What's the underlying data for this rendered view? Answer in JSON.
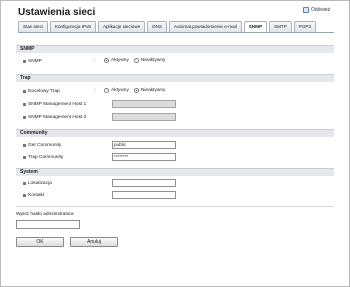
{
  "header": {
    "title": "Ustawienia sieci",
    "refresh_label": "Odśwież"
  },
  "tabs": [
    {
      "label": "Stan sieci",
      "active": false
    },
    {
      "label": "Konfiguracja IPv6",
      "active": false
    },
    {
      "label": "Aplikacje sieciowe",
      "active": false
    },
    {
      "label": "DNS",
      "active": false
    },
    {
      "label": "Automat.powiadomienie e-mail",
      "active": false
    },
    {
      "label": "SNMP",
      "active": true
    },
    {
      "label": "SMTP",
      "active": false
    },
    {
      "label": "POP3",
      "active": false
    }
  ],
  "snmp": {
    "section_title": "SNMP",
    "label": "SNMP",
    "option_on": "Aktywny",
    "option_off": "Nieaktywny",
    "selected": "Aktywny"
  },
  "trap": {
    "section_title": "Trap",
    "target_label": "Docelowy Trap",
    "option_on": "Aktywny",
    "option_off": "Nieaktywny",
    "selected": "Nieaktywny",
    "host1_label": "SNMP Management Host 1",
    "host1_value": "",
    "host2_label": "SNMP Management Host 2",
    "host2_value": ""
  },
  "community": {
    "section_title": "Community",
    "get_label": "Get Community",
    "get_value": "public",
    "trap_label": "Trap Community",
    "trap_value": "********"
  },
  "system": {
    "section_title": "System",
    "location_label": "Lokalizacja",
    "location_value": "",
    "contact_label": "Kontakt",
    "contact_value": ""
  },
  "admin": {
    "password_label": "Wpisz hasło administratora",
    "password_value": ""
  },
  "buttons": {
    "ok": "OK",
    "cancel": "Anuluj"
  },
  "colors": {
    "section_bg": "#e4e7eb",
    "disabled_field": "#dcdcdc",
    "border": "#8f8f8f"
  }
}
